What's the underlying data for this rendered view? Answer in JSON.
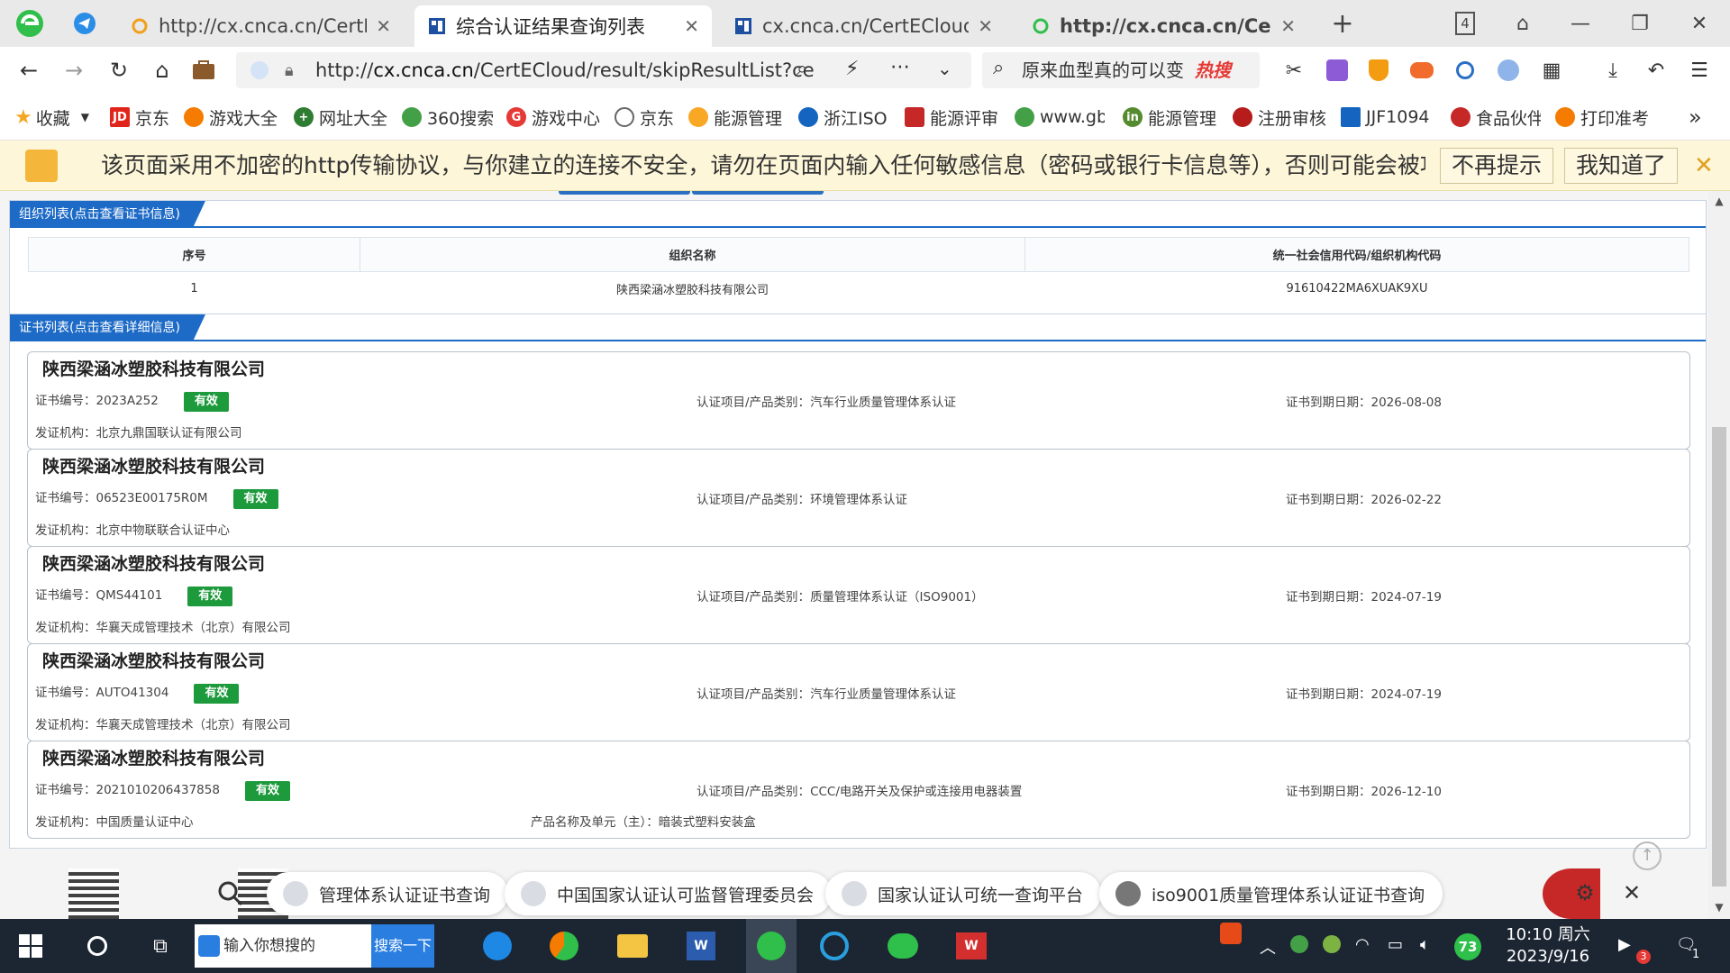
{
  "browser": {
    "tabs": [
      {
        "title": "http://cx.cnca.cn/CertECloud/result/skipResultList",
        "active": false,
        "bold": false
      },
      {
        "title": "综合认证结果查询列表",
        "active": true,
        "bold": false
      },
      {
        "title": "cx.cnca.cn/CertECloud/result/skipResultList",
        "active": false,
        "bold": false
      },
      {
        "title": "http://cx.cnca.cn/CertECloud",
        "active": false,
        "bold": true
      }
    ],
    "new_tab": "+",
    "window_counter": "4",
    "url_host": "cx.cnca.cn",
    "url_prefix": "http://",
    "url_path": "/CertECloud/result/skipResultList?ce",
    "search_text": "原来血型真的可以变",
    "hot_label": "热搜"
  },
  "bookmarks": [
    {
      "label": "收藏",
      "color": "#f5a623"
    },
    {
      "label": "京东",
      "color": "#e1251b"
    },
    {
      "label": "游戏大全",
      "color": "#f57c00"
    },
    {
      "label": "网址大全",
      "color": "#2e7d32"
    },
    {
      "label": "360搜索",
      "color": "#43a047"
    },
    {
      "label": "游戏中心",
      "color": "#e53935"
    },
    {
      "label": "京东",
      "color": "#666666"
    },
    {
      "label": "能源管理",
      "color": "#f9a825"
    },
    {
      "label": "浙江ISO",
      "color": "#1565c0"
    },
    {
      "label": "能源评审",
      "color": "#c62828"
    },
    {
      "label": "www.gb",
      "color": "#43a047"
    },
    {
      "label": "能源管理",
      "color": "#558b2f"
    },
    {
      "label": "注册审核",
      "color": "#b71c1c"
    },
    {
      "label": "JJF1094",
      "color": "#1565c0"
    },
    {
      "label": "食品伙伴",
      "color": "#c62828"
    },
    {
      "label": "打印准考",
      "color": "#f57c00"
    }
  ],
  "warning": {
    "text": "该页面采用不加密的http传输协议，与你建立的连接不安全，请勿在页面内输入任何敏感信息（密码或银行卡信息等），否则可能会被攻击",
    "btn_dismiss": "不再提示",
    "btn_ok": "我知道了"
  },
  "org_panel": {
    "title": "组织列表(点击查看证书信息)",
    "headers": [
      "序号",
      "组织名称",
      "统一社会信用代码/组织机构代码"
    ],
    "rows": [
      {
        "index": "1",
        "name": "陕西梁涵冰塑胶科技有限公司",
        "code": "91610422MA6XUAK9XU"
      }
    ]
  },
  "cert_panel": {
    "title": "证书列表(点击查看详细信息)",
    "labels": {
      "number": "证书编号：",
      "project": "认证项目/产品类别：",
      "expiry": "证书到期日期：",
      "issuer": "发证机构：",
      "product": "产品名称及单元（主）："
    },
    "certs": [
      {
        "company": "陕西梁涵冰塑胶科技有限公司",
        "number": "2023A252",
        "status": "有效",
        "project": "汽车行业质量管理体系认证",
        "expiry": "2026-08-08",
        "issuer": "北京九鼎国联认证有限公司",
        "product": ""
      },
      {
        "company": "陕西梁涵冰塑胶科技有限公司",
        "number": "06523E00175R0M",
        "status": "有效",
        "project": "环境管理体系认证",
        "expiry": "2026-02-22",
        "issuer": "北京中物联联合认证中心",
        "product": ""
      },
      {
        "company": "陕西梁涵冰塑胶科技有限公司",
        "number": "QMS44101",
        "status": "有效",
        "project": "质量管理体系认证（ISO9001）",
        "expiry": "2024-07-19",
        "issuer": "华襄天成管理技术（北京）有限公司",
        "product": ""
      },
      {
        "company": "陕西梁涵冰塑胶科技有限公司",
        "number": "AUTO41304",
        "status": "有效",
        "project": "汽车行业质量管理体系认证",
        "expiry": "2024-07-19",
        "issuer": "华襄天成管理技术（北京）有限公司",
        "product": ""
      },
      {
        "company": "陕西梁涵冰塑胶科技有限公司",
        "number": "2021010206437858",
        "status": "有效",
        "project": "CCC/电路开关及保护或连接用电器装置",
        "expiry": "2026-12-10",
        "issuer": "中国质量认证中心",
        "product": "暗装式塑料安装盒"
      }
    ]
  },
  "hot_search": [
    {
      "label": "管理体系认证证书查询"
    },
    {
      "label": "中国国家认证认可监督管理委员会"
    },
    {
      "label": "国家认证认可统一查询平台"
    },
    {
      "label": "iso9001质量管理体系认证证书查询"
    }
  ],
  "taskbar": {
    "search_placeholder": "输入你想搜的",
    "search_btn": "搜索一下",
    "time": "10:10 周六",
    "date": "2023/9/16",
    "battery_badge": "73",
    "notify_count": "1",
    "mail_count": "3"
  },
  "colors": {
    "accent": "#1e6bc7",
    "valid_badge": "#1d9a3c",
    "warning_bg": "#fdf6d8",
    "taskbar_bg": "#1c2633"
  }
}
